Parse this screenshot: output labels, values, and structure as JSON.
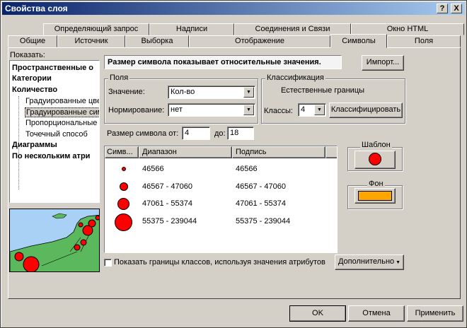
{
  "window": {
    "title": "Свойства слоя",
    "help_btn": "?",
    "close_btn": "X"
  },
  "tabs_back": [
    "Определяющий запрос",
    "Надписи",
    "Соединения и Связи",
    "Окно HTML"
  ],
  "tabs_front": [
    "Общие",
    "Источник",
    "Выборка",
    "Отображение",
    "Символы",
    "Поля"
  ],
  "show": {
    "label": "Показать:",
    "items": [
      {
        "label": "Пространственные о",
        "bold": true
      },
      {
        "label": "Категории",
        "bold": true
      },
      {
        "label": "Количество",
        "bold": true
      },
      {
        "label": "Градуированные цве",
        "bold": false
      },
      {
        "label": "Градуированные сим",
        "bold": false,
        "selected": true
      },
      {
        "label": "Пропорциональные",
        "bold": false
      },
      {
        "label": "Точечный способ",
        "bold": false
      },
      {
        "label": "Диаграммы",
        "bold": true
      },
      {
        "label": "По нескольким атри",
        "bold": true
      }
    ]
  },
  "heading": "Размер символа показывает относительные значения.",
  "import_btn": "Импорт...",
  "fields": {
    "group": "Поля",
    "value_label": "Значение:",
    "value": "Кол-во",
    "norm_label": "Нормирование:",
    "norm": "нет"
  },
  "classification": {
    "group": "Классификация",
    "method": "Естественные границы",
    "classes_label": "Классы:",
    "classes": "4",
    "classify_btn": "Классифицировать"
  },
  "size": {
    "from_label": "Размер символа от:",
    "from": "4",
    "to_label": "до:",
    "to": "18"
  },
  "table": {
    "headers": [
      "Симв...",
      "Диапазон",
      "Подпись"
    ],
    "rows": [
      {
        "range": "46566",
        "label": "46566"
      },
      {
        "range": "46567 - 47060",
        "label": "46567 - 47060"
      },
      {
        "range": "47061 - 55374",
        "label": "47061 - 55374"
      },
      {
        "range": "55375 - 239044",
        "label": "55375 - 239044"
      }
    ]
  },
  "template": {
    "label": "Шаблон",
    "color": "#ff0000"
  },
  "background": {
    "label": "Фон",
    "color": "#ffa500"
  },
  "show_bounds": "Показать границы классов, используя значения атрибутов",
  "advanced_btn": "Дополнительно",
  "buttons": {
    "ok": "OK",
    "cancel": "Отмена",
    "apply": "Применить"
  }
}
